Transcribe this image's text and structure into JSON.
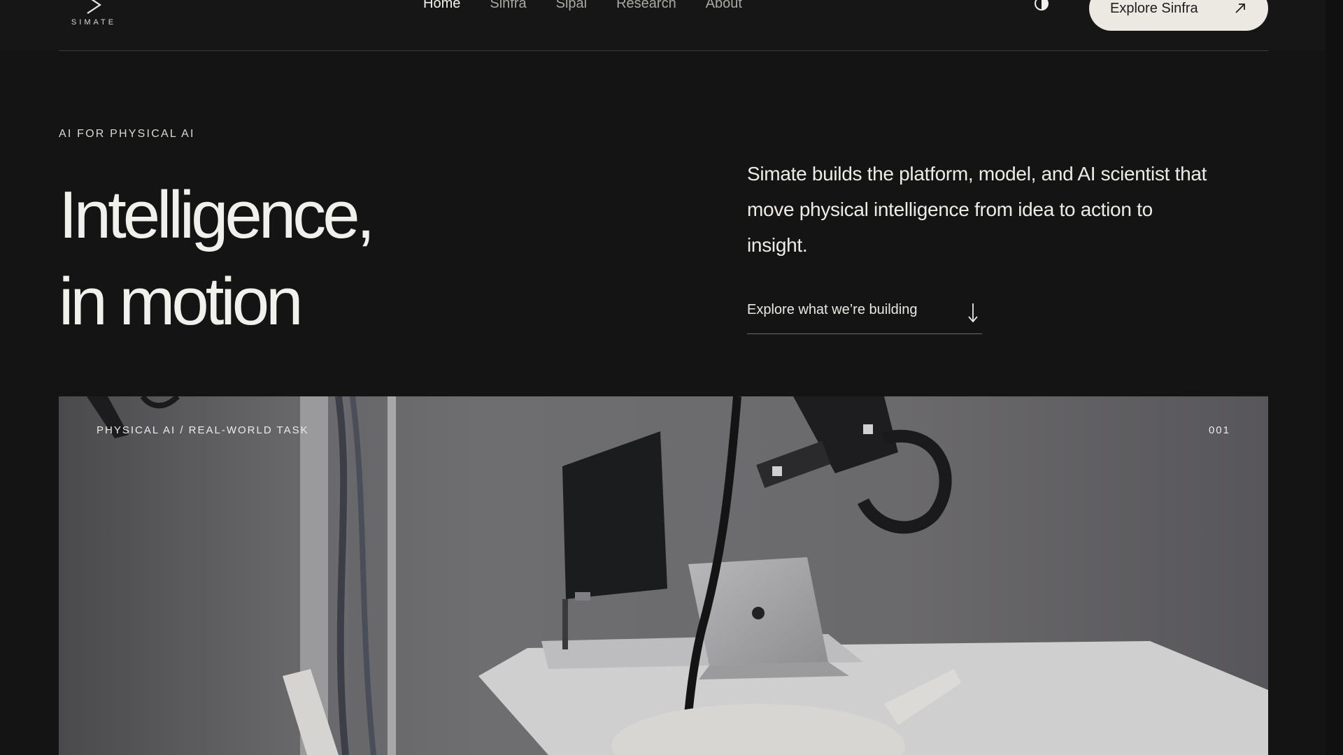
{
  "brand": {
    "wordmark": "SIMATE",
    "icon": "chevron-right-logo-icon"
  },
  "nav": {
    "items": [
      {
        "label": "Home",
        "active": true
      },
      {
        "label": "Sinfra",
        "active": false
      },
      {
        "label": "Sipai",
        "active": false
      },
      {
        "label": "Research",
        "active": false
      },
      {
        "label": "About",
        "active": false
      }
    ]
  },
  "header": {
    "theme_toggle_icon": "contrast-icon",
    "cta_label": "Explore Sinfra",
    "cta_icon": "arrow-up-right-icon"
  },
  "hero": {
    "eyebrow": "AI FOR PHYSICAL AI",
    "headline_line1": "Intelligence,",
    "headline_line2": "in motion",
    "description": "Simate builds the platform, model, and AI scientist that move physical intelligence from idea to action to insight.",
    "explore_label": "Explore what we’re building",
    "explore_icon": "arrow-down-icon"
  },
  "media": {
    "caption": "PHYSICAL AI / REAL-WORLD TASK",
    "index": "001"
  },
  "colors": {
    "background": "#141414",
    "text": "#f0f0ec",
    "muted_text": "#a9a9a4",
    "button_bg": "#ece9e3"
  }
}
